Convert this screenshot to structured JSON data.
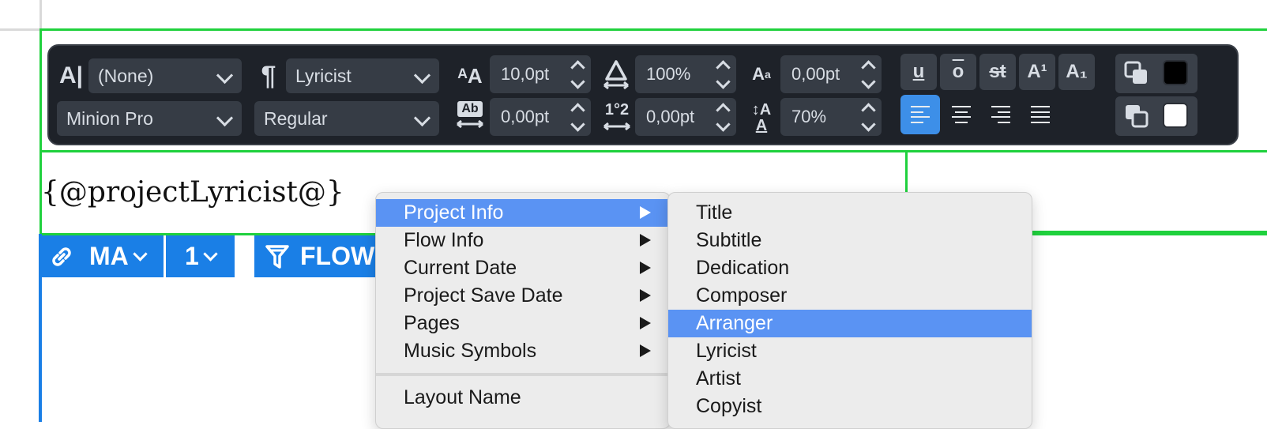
{
  "toolbar": {
    "paragraph_style": "(None)",
    "character_style": "Lyricist",
    "font_family": "Minion Pro",
    "font_style": "Regular",
    "font_size": "10,0pt",
    "horizontal_scale": "100%",
    "baseline_shift": "0,00pt",
    "tracking": "0,00pt",
    "kerning": "0,00pt",
    "line_spacing": "70%",
    "format_buttons": [
      "u",
      "o",
      "st",
      "A¹",
      "A₁"
    ],
    "paragraph_alignment_active": "left",
    "fg_swatch_color": "#000000",
    "bg_swatch_color": "#ffffff"
  },
  "frame": {
    "text": "{@projectLyricist@}"
  },
  "frame_tabs": {
    "link_label": "MA",
    "page_label": "1",
    "filter_label": "FLOW"
  },
  "context_menu": {
    "items": [
      {
        "label": "Project Info",
        "submenu": true,
        "highlighted": true
      },
      {
        "label": "Flow Info",
        "submenu": true
      },
      {
        "label": "Current Date",
        "submenu": true
      },
      {
        "label": "Project Save Date",
        "submenu": true
      },
      {
        "label": "Pages",
        "submenu": true
      },
      {
        "label": "Music Symbols",
        "submenu": true
      },
      {
        "label": "Layout Name",
        "submenu": false
      }
    ]
  },
  "submenu": {
    "items": [
      {
        "label": "Title"
      },
      {
        "label": "Subtitle"
      },
      {
        "label": "Dedication"
      },
      {
        "label": "Composer"
      },
      {
        "label": "Arranger",
        "highlighted": true
      },
      {
        "label": "Lyricist"
      },
      {
        "label": "Artist"
      },
      {
        "label": "Copyist"
      }
    ]
  },
  "colors": {
    "frame_green": "#1fd13d",
    "frame_blue": "#1a7fe6",
    "menu_highlight": "#5a93f3",
    "toolbar_bg": "#1e2229"
  }
}
